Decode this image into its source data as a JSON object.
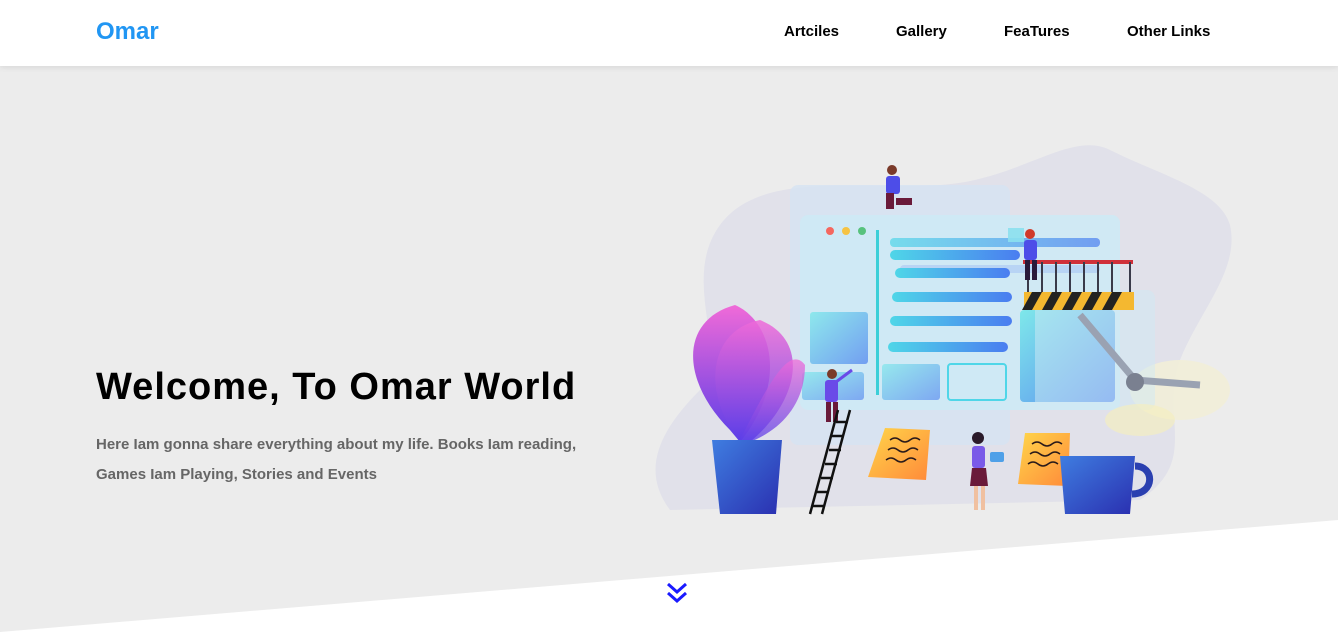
{
  "header": {
    "logo": "Omar",
    "nav": [
      {
        "label": "Artciles"
      },
      {
        "label": "Gallery"
      },
      {
        "label": "FeaTures"
      },
      {
        "label": "Other Links"
      }
    ]
  },
  "hero": {
    "title": "Welcome, To Omar World",
    "text": "Here Iam gonna share everything about my life. Books Iam reading, Games Iam Playing, Stories and Events"
  },
  "icons": {
    "scroll": "double-chevron-down-icon"
  },
  "colors": {
    "brand": "#2196f3",
    "hero_bg": "#ececec",
    "arrow": "#1a1aff"
  }
}
